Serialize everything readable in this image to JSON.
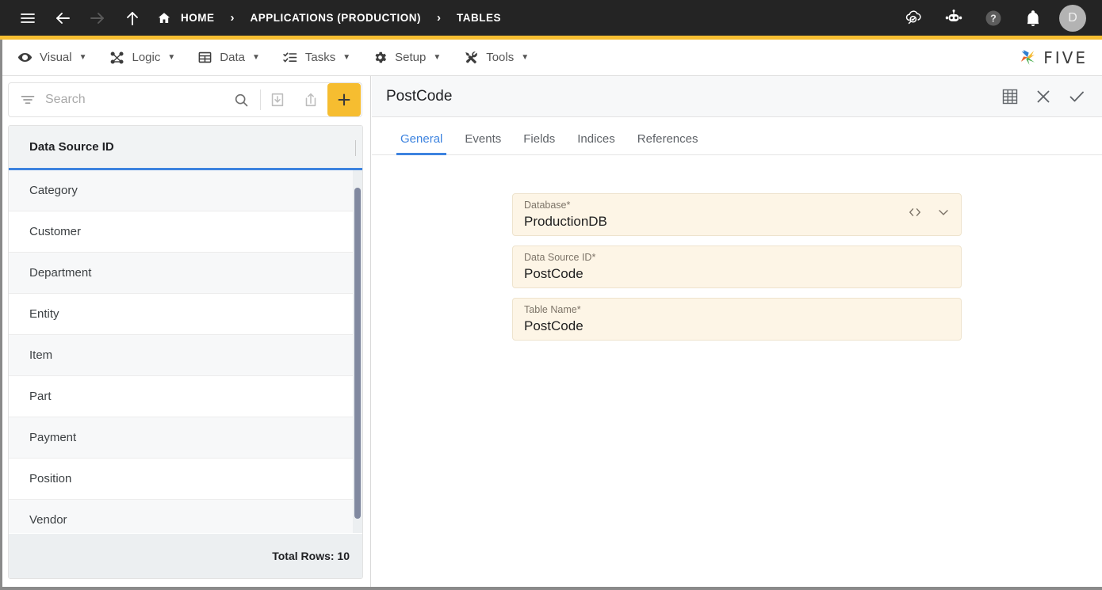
{
  "topbar": {
    "menu_icon": "hamburger-icon",
    "back_icon": "arrow-left-icon",
    "forward_icon": "arrow-right-icon",
    "up_icon": "arrow-up-icon",
    "home_label": "HOME",
    "separator": "›",
    "breadcrumbs": [
      {
        "label": "APPLICATIONS (PRODUCTION)"
      },
      {
        "label": "TABLES"
      }
    ],
    "right_icons": [
      {
        "name": "cloud-check-icon"
      },
      {
        "name": "robot-assistant-icon"
      },
      {
        "name": "help-icon"
      },
      {
        "name": "notifications-bell-icon"
      }
    ],
    "avatar_initial": "D",
    "background": "#242424",
    "accent_stripe": "#f6bd30"
  },
  "menubar": {
    "items": [
      {
        "label": "Visual",
        "icon": "eye-icon",
        "caret": "▼"
      },
      {
        "label": "Logic",
        "icon": "logic-nodes-icon",
        "caret": "▼"
      },
      {
        "label": "Data",
        "icon": "table-grid-icon",
        "caret": "▼"
      },
      {
        "label": "Tasks",
        "icon": "checklist-icon",
        "caret": "▼"
      },
      {
        "label": "Setup",
        "icon": "gear-icon",
        "caret": "▼"
      },
      {
        "label": "Tools",
        "icon": "tools-icon",
        "caret": "▼"
      }
    ],
    "logo_text": "FIVE"
  },
  "sidebar": {
    "search": {
      "placeholder": "Search",
      "value": "",
      "filter_icon": "filter-icon",
      "search_icon": "search-icon",
      "import_icon": "import-icon",
      "export_icon": "export-icon",
      "add_label": "+"
    },
    "grid": {
      "column_header": "Data Source ID",
      "rows": [
        {
          "label": "Category"
        },
        {
          "label": "Customer"
        },
        {
          "label": "Department"
        },
        {
          "label": "Entity"
        },
        {
          "label": "Item"
        },
        {
          "label": "Part"
        },
        {
          "label": "Payment"
        },
        {
          "label": "Position"
        },
        {
          "label": "Vendor"
        }
      ],
      "footer": "Total Rows: 10",
      "header_underline_color": "#3d83df"
    }
  },
  "detail": {
    "title": "PostCode",
    "actions": [
      {
        "name": "table-view-icon"
      },
      {
        "name": "close-icon"
      },
      {
        "name": "confirm-check-icon"
      }
    ],
    "tabs": [
      {
        "label": "General",
        "active": true
      },
      {
        "label": "Events",
        "active": false
      },
      {
        "label": "Fields",
        "active": false
      },
      {
        "label": "Indices",
        "active": false
      },
      {
        "label": "References",
        "active": false
      }
    ],
    "fields": [
      {
        "label": "Database",
        "required": "*",
        "value": "ProductionDB",
        "has_code_icon": true,
        "has_dropdown": true
      },
      {
        "label": "Data Source ID",
        "required": "*",
        "value": "PostCode",
        "has_code_icon": false,
        "has_dropdown": false
      },
      {
        "label": "Table Name",
        "required": "*",
        "value": "PostCode",
        "has_code_icon": false,
        "has_dropdown": false
      }
    ],
    "field_background": "#fdf5e6",
    "accent_color": "#3d83df"
  }
}
